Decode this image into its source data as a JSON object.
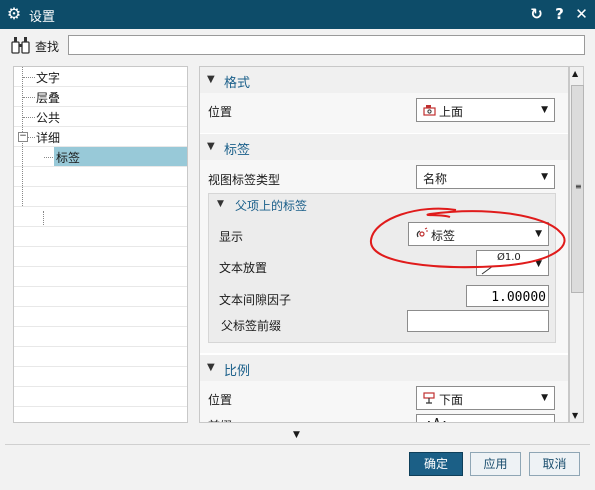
{
  "window": {
    "title": "设置",
    "refresh_icon": "↻",
    "help_icon": "?",
    "close_icon": "✕"
  },
  "search": {
    "label": "查找",
    "value": ""
  },
  "tree": {
    "items": [
      {
        "label": "文字"
      },
      {
        "label": "层叠"
      },
      {
        "label": "公共"
      },
      {
        "label": "详细",
        "expander": "−"
      },
      {
        "label": "标签",
        "selected": true
      }
    ]
  },
  "sections": {
    "format": {
      "title": "格式",
      "position_label": "位置",
      "position_value": "上面"
    },
    "label": {
      "title": "标签",
      "view_label_type_label": "视图标签类型",
      "view_label_type_value": "名称",
      "parent": {
        "title": "父项上的标签",
        "display_label": "显示",
        "display_value": "标签",
        "text_placement_label": "文本放置",
        "text_placement_value": "Ø1.0",
        "text_gap_factor_label": "文本间隙因子",
        "text_gap_factor_value": "1.00000",
        "parent_label_prefix_label": "父标签前缀",
        "parent_label_prefix_value": ""
      }
    },
    "scale": {
      "title": "比例",
      "position_label": "位置",
      "position_value": "下面",
      "prefix_label": "前缀",
      "prefix_value": ":A:"
    }
  },
  "buttons": {
    "ok": "确定",
    "apply": "应用",
    "cancel": "取消"
  },
  "colors": {
    "titlebar": "#0d4c69",
    "accent": "#1b5f86",
    "annotation": "#e01b1b",
    "selection": "#98c9d8"
  }
}
